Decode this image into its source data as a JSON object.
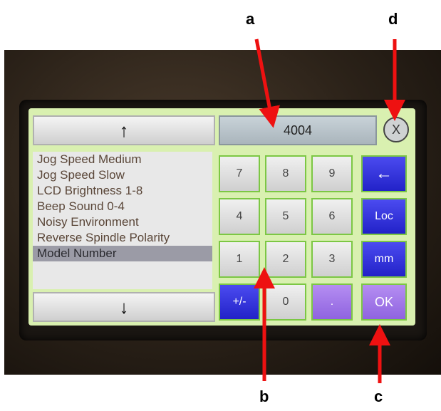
{
  "annotations": {
    "a": "a",
    "b": "b",
    "c": "c",
    "d": "d"
  },
  "panel": {
    "up_arrow": "↑",
    "down_arrow": "↓",
    "list_items": [
      "Jog Speed Medium",
      "Jog Speed Slow",
      "LCD Brightness 1-8",
      "Beep Sound 0-4",
      "Noisy Environment",
      "Reverse Spindle Polarity",
      "Model Number"
    ],
    "selected_item": "Model Number",
    "display_value": "4004",
    "close_label": "X"
  },
  "keypad": {
    "k7": "7",
    "k8": "8",
    "k9": "9",
    "backspace": "←",
    "k4": "4",
    "k5": "5",
    "k6": "6",
    "loc": "Loc",
    "k1": "1",
    "k2": "2",
    "k3": "3",
    "mm": "mm",
    "plusminus": "+/-",
    "k0": "0",
    "dot": ".",
    "ok": "OK"
  },
  "colors": {
    "arrow": "#ee1111",
    "screen_bg": "#d9f0b0",
    "blue_key": "#2a2ad8",
    "purple_key": "#9a6fe6"
  }
}
